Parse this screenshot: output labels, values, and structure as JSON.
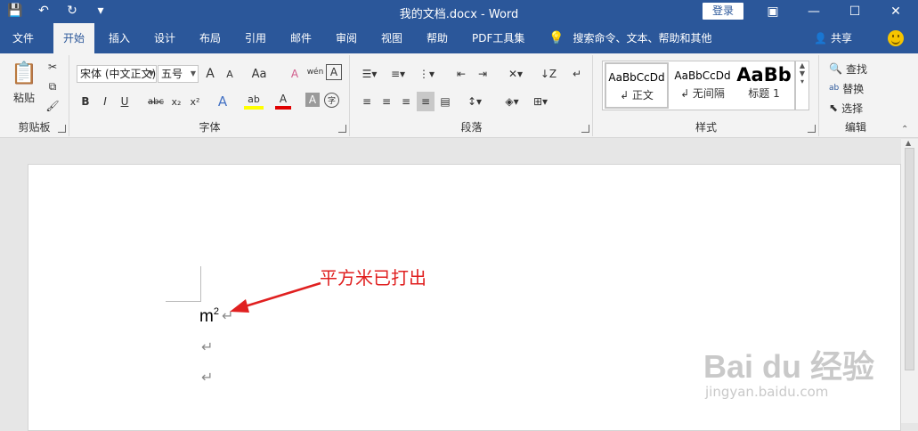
{
  "titlebar": {
    "title": "我的文档.docx  -  Word",
    "login": "登录",
    "save_icon": "💾",
    "undo_icon": "↶",
    "redo_icon": "↻",
    "customize_icon": "▾",
    "ribbon_display_icon": "▣",
    "minimize_icon": "—",
    "maximize_icon": "☐",
    "close_icon": "✕"
  },
  "tabs": [
    {
      "label": "文件"
    },
    {
      "label": "开始"
    },
    {
      "label": "插入"
    },
    {
      "label": "设计"
    },
    {
      "label": "布局"
    },
    {
      "label": "引用"
    },
    {
      "label": "邮件"
    },
    {
      "label": "审阅"
    },
    {
      "label": "视图"
    },
    {
      "label": "帮助"
    },
    {
      "label": "PDF工具集"
    }
  ],
  "search": {
    "label": "搜索命令、文本、帮助和其他"
  },
  "share": {
    "label": "共享"
  },
  "clipboard": {
    "paste": "粘贴",
    "group_label": "剪贴板"
  },
  "font": {
    "family": "宋体 (中文正文)",
    "size": "五号",
    "group_label": "字体",
    "bold": "B",
    "italic": "I",
    "underline": "U",
    "strike": "abc",
    "sub": "x₂",
    "sup": "x²",
    "grow": "A",
    "shrink": "A",
    "case": "Aa",
    "clear": "A",
    "phonetic": "wén",
    "border": "A",
    "effects": "A",
    "highlight": "ab",
    "color": "A",
    "shade": "A",
    "enclose": "字"
  },
  "paragraph": {
    "group_label": "段落"
  },
  "styles": {
    "group_label": "样式",
    "items": [
      {
        "preview": "AaBbCcDd",
        "name": "↲ 正文"
      },
      {
        "preview": "AaBbCcDd",
        "name": "↲ 无间隔"
      },
      {
        "preview": "AaBb",
        "name": "标题 1"
      }
    ]
  },
  "editing": {
    "find": "查找",
    "replace": "替换",
    "select": "选择",
    "group_label": "编辑"
  },
  "document": {
    "base": "m",
    "superscript": "2",
    "para_mark": "↵",
    "annotation": "平方米已打出"
  },
  "watermark": {
    "main": "Bai du 经验",
    "url": "jingyan.baidu.com"
  },
  "colors": {
    "brand": "#2b579a",
    "annotation": "#e02020"
  }
}
